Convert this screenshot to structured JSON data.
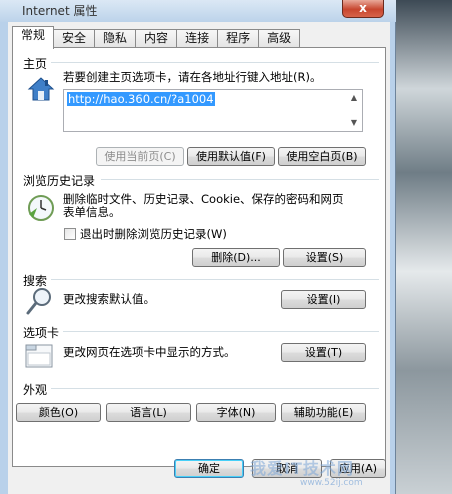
{
  "window": {
    "title": "Internet 属性",
    "close_label": "x"
  },
  "tabs": [
    {
      "label": "常规",
      "active": true
    },
    {
      "label": "安全",
      "active": false
    },
    {
      "label": "隐私",
      "active": false
    },
    {
      "label": "内容",
      "active": false
    },
    {
      "label": "连接",
      "active": false
    },
    {
      "label": "程序",
      "active": false
    },
    {
      "label": "高级",
      "active": false
    }
  ],
  "homepage": {
    "section_label": "主页",
    "description": "若要创建主页选项卡，请在各地址行键入地址(R)。",
    "url_value": "http://hao.360.cn/?a1004",
    "use_current_label": "使用当前页(C)",
    "use_default_label": "使用默认值(F)",
    "use_blank_label": "使用空白页(B)"
  },
  "history": {
    "section_label": "浏览历史记录",
    "description_line1": "删除临时文件、历史记录、Cookie、保存的密码和网页",
    "description_line2": "表单信息。",
    "checkbox_label": "退出时删除浏览历史记录(W)",
    "checkbox_checked": false,
    "delete_label": "删除(D)...",
    "settings_label": "设置(S)"
  },
  "search": {
    "section_label": "搜索",
    "description": "更改搜索默认值。",
    "settings_label": "设置(I)"
  },
  "tabs_section": {
    "section_label": "选项卡",
    "description": "更改网页在选项卡中显示的方式。",
    "settings_label": "设置(T)"
  },
  "appearance": {
    "section_label": "外观",
    "colors_label": "颜色(O)",
    "languages_label": "语言(L)",
    "fonts_label": "字体(N)",
    "accessibility_label": "辅助功能(E)"
  },
  "footer": {
    "ok_label": "确定",
    "cancel_label": "取消",
    "apply_label": "应用(A)"
  },
  "watermark": {
    "text": "我爱IT技术网",
    "url": "www.52ij.com"
  },
  "colors": {
    "selection": "#3399ff",
    "window_frame": "#b9d1ea",
    "close_button": "#c7462f"
  }
}
